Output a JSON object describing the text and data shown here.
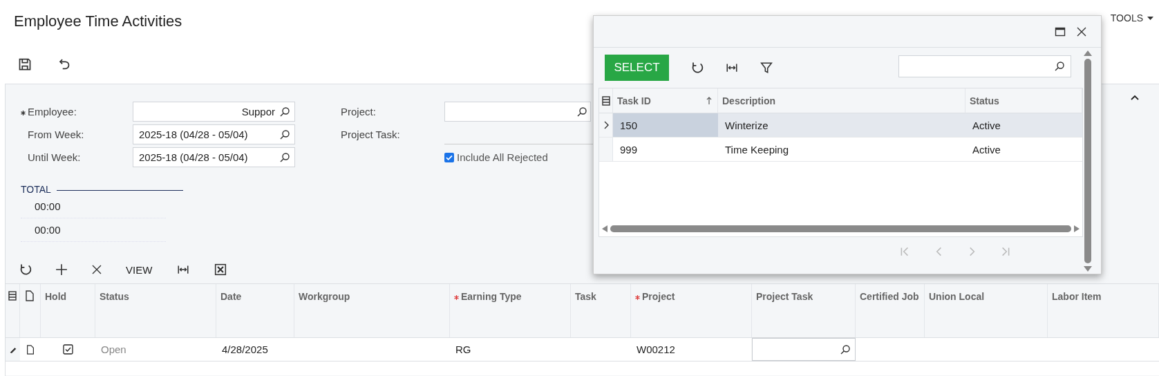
{
  "page_title": "Employee Time Activities",
  "top_menu": [
    {
      "label": "TOOLS",
      "kind": "dropdown"
    }
  ],
  "form": {
    "fields": [
      {
        "label": "Employee:",
        "value": "Suppor",
        "required": true
      },
      {
        "label": "From Week:",
        "value": "2025-18 (04/28 - 05/04)",
        "required": false
      },
      {
        "label": "Until Week:",
        "value": "2025-18 (04/28 - 05/04)",
        "required": false
      }
    ],
    "right_fields": [
      {
        "label": "Project:",
        "kind": "lookup"
      },
      {
        "label": "Project Task:",
        "kind": "line"
      }
    ],
    "include_all_rejected": {
      "label": "Include All Rejected",
      "checked": true
    },
    "total": {
      "label": "TOTAL",
      "values": [
        "00:00",
        "00:00"
      ]
    }
  },
  "grid_toolbar": {
    "view_label": "VIEW"
  },
  "grid": {
    "columns": [
      {
        "label": "Hold",
        "required": false
      },
      {
        "label": "Status",
        "required": false
      },
      {
        "label": "Date",
        "required": false
      },
      {
        "label": "Workgroup",
        "required": false
      },
      {
        "label": "Earning Type",
        "required": true
      },
      {
        "label": "Task",
        "required": false
      },
      {
        "label": "Project",
        "required": true
      },
      {
        "label": "Project Task",
        "required": false
      },
      {
        "label": "Certified Job",
        "required": false
      },
      {
        "label": "Union Local",
        "required": false
      },
      {
        "label": "Labor Item",
        "required": false
      }
    ],
    "rows": [
      {
        "cells": [
          {
            "kind": "checkbox",
            "checked": true
          },
          {
            "kind": "text",
            "text": "Open",
            "disabled": true
          },
          {
            "kind": "text",
            "text": "4/28/2025",
            "disabled": false
          },
          {
            "kind": "empty"
          },
          {
            "kind": "text",
            "text": "RG",
            "disabled": false
          },
          {
            "kind": "empty"
          },
          {
            "kind": "text",
            "text": "W00212",
            "disabled": false
          },
          {
            "kind": "editor"
          },
          {
            "kind": "empty"
          },
          {
            "kind": "empty"
          },
          {
            "kind": "empty"
          }
        ]
      }
    ]
  },
  "lookup_dialog": {
    "select_label": "SELECT",
    "columns": [
      {
        "label": "Task ID",
        "sorted": true
      },
      {
        "label": "Description",
        "sorted": false
      },
      {
        "label": "Status",
        "sorted": false
      }
    ],
    "rows": [
      {
        "task_id": "150",
        "description": "Winterize",
        "status": "Active",
        "selected": true
      },
      {
        "task_id": "999",
        "description": "Time Keeping",
        "status": "Active",
        "selected": false
      }
    ]
  }
}
